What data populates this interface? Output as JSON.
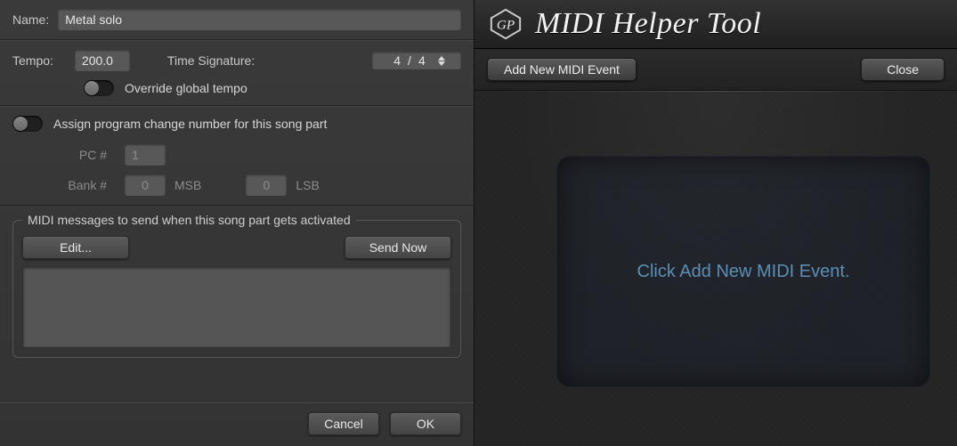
{
  "left": {
    "name_label": "Name:",
    "name_value": "Metal solo",
    "tempo_label": "Tempo:",
    "tempo_value": "200.0",
    "timesig_label": "Time Signature:",
    "timesig_num": "4",
    "timesig_den": "4",
    "override_label": "Override global tempo",
    "assign_label": "Assign program change number for this song part",
    "pc_label": "PC #",
    "pc_value": "1",
    "bank_label": "Bank #",
    "msb_value": "0",
    "msb_label": "MSB",
    "lsb_value": "0",
    "lsb_label": "LSB",
    "midi_legend": "MIDI messages to send when this song part gets activated",
    "edit_label": "Edit...",
    "sendnow_label": "Send Now",
    "cancel_label": "Cancel",
    "ok_label": "OK"
  },
  "right": {
    "title": "MIDI Helper Tool",
    "add_label": "Add New MIDI Event",
    "close_label": "Close",
    "drop_text": "Click Add New MIDI Event."
  }
}
